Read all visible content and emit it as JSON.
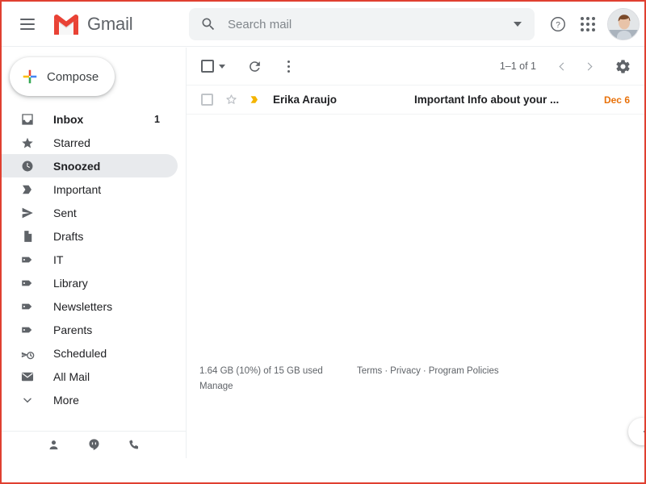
{
  "window": {
    "border_color": "#e04030"
  },
  "header": {
    "menu_icon": "hamburger-menu-icon",
    "brand": "Gmail",
    "logo_icon": "gmail-m-logo",
    "search": {
      "icon": "search-icon",
      "placeholder": "Search mail",
      "value": "",
      "options_icon": "chevron-down-icon"
    },
    "help_icon": "help-question-circle-icon",
    "apps_icon": "apps-grid-icon",
    "avatar": "user-avatar-photo"
  },
  "sidebar": {
    "compose": {
      "label": "Compose",
      "icon": "plus-icon"
    },
    "items": [
      {
        "label": "Inbox",
        "icon": "inbox-icon",
        "count": "1",
        "active": false,
        "bold": true
      },
      {
        "label": "Starred",
        "icon": "star-icon",
        "count": "",
        "active": false,
        "bold": false
      },
      {
        "label": "Snoozed",
        "icon": "clock-icon",
        "count": "",
        "active": true,
        "bold": true
      },
      {
        "label": "Important",
        "icon": "important-marker-icon",
        "count": "",
        "active": false,
        "bold": false
      },
      {
        "label": "Sent",
        "icon": "send-arrow-icon",
        "count": "",
        "active": false,
        "bold": false
      },
      {
        "label": "Drafts",
        "icon": "draft-document-icon",
        "count": "",
        "active": false,
        "bold": false
      },
      {
        "label": "IT",
        "icon": "label-tag-icon",
        "count": "",
        "active": false,
        "bold": false
      },
      {
        "label": "Library",
        "icon": "label-tag-icon",
        "count": "",
        "active": false,
        "bold": false
      },
      {
        "label": "Newsletters",
        "icon": "label-tag-icon",
        "count": "",
        "active": false,
        "bold": false
      },
      {
        "label": "Parents",
        "icon": "label-tag-icon",
        "count": "",
        "active": false,
        "bold": false
      },
      {
        "label": "Scheduled",
        "icon": "scheduled-send-icon",
        "count": "",
        "active": false,
        "bold": false
      },
      {
        "label": "All Mail",
        "icon": "envelope-icon",
        "count": "",
        "active": false,
        "bold": false
      },
      {
        "label": "More",
        "icon": "chevron-down-icon",
        "count": "",
        "active": false,
        "bold": false
      }
    ],
    "bottom_bar": [
      {
        "icon": "contacts-person-icon"
      },
      {
        "icon": "hangouts-chat-icon"
      },
      {
        "icon": "phone-call-icon"
      }
    ]
  },
  "callout": {
    "number": "1",
    "color": "#e3883c"
  },
  "toolbar": {
    "select_all_icon": "checkbox-icon",
    "select_all_caret_icon": "chevron-down-icon",
    "refresh_icon": "refresh-icon",
    "more_icon": "kebab-more-icon",
    "page_range": "1–1 of 1",
    "prev_icon": "chevron-left-icon",
    "next_icon": "chevron-right-icon",
    "settings_icon": "gear-icon"
  },
  "email_list": {
    "rows": [
      {
        "checkbox_icon": "checkbox-icon",
        "star_icon": "star-outline-icon",
        "important_icon": "important-marker-icon",
        "sender": "Erika Araujo",
        "subject": "Important Info about your ...",
        "date": "Dec 6",
        "date_color": "#e8710a"
      }
    ]
  },
  "footer": {
    "storage": "1.64 GB (10%) of 15 GB used",
    "manage": "Manage",
    "legal": [
      {
        "label": "Terms"
      },
      {
        "label": "Privacy"
      },
      {
        "label": "Program Policies"
      }
    ],
    "separator": "·"
  },
  "side_toggle": {
    "icon": "chevron-left-icon"
  }
}
